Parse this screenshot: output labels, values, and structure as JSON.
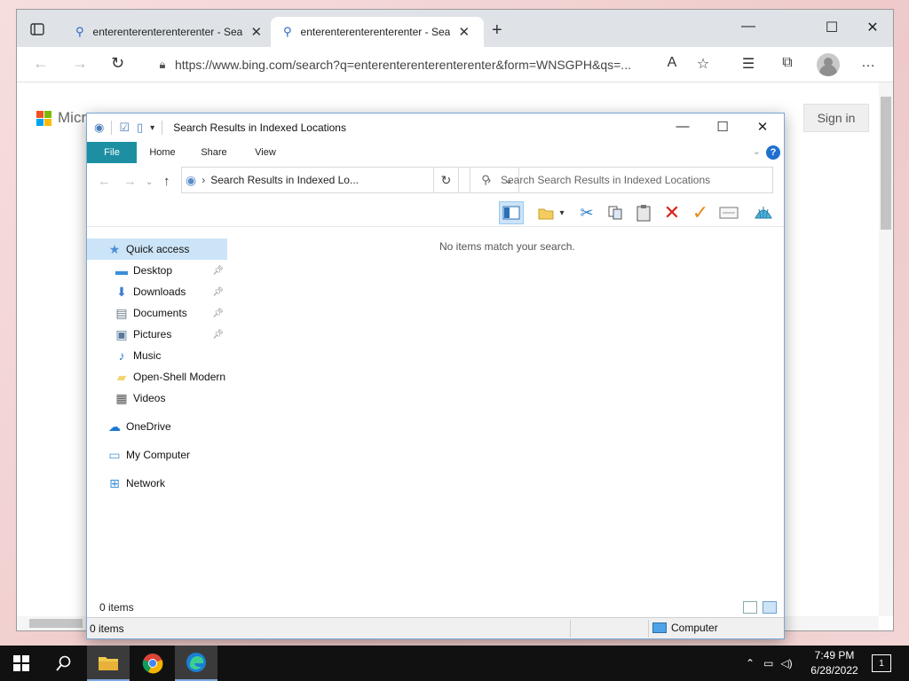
{
  "browser": {
    "tabs": [
      {
        "label": "enterenterenterenterenter - Search",
        "close": "✕"
      },
      {
        "label": "enterenterenterenterenter - Search",
        "close": "✕"
      }
    ],
    "new_tab": "+",
    "url": "https://www.bing.com/search?q=enterenterenterenterenter&form=WNSGPH&qs=...",
    "window_controls": {
      "minimize": "—",
      "maximize": "☐",
      "close": "✕"
    }
  },
  "bing": {
    "logo_text": "Micro",
    "sign_in": "Sign in",
    "logo_colors": [
      "#f25022",
      "#7fba00",
      "#00a4ef",
      "#ffb900"
    ]
  },
  "explorer": {
    "title": "Search Results in Indexed Locations",
    "ribbon_tabs": [
      "File",
      "Home",
      "Share",
      "View"
    ],
    "path_text": "Search Results in Indexed Lo...",
    "search_placeholder": "Search Search Results in Indexed Locations",
    "empty_message": "No items match your search.",
    "nav_items": [
      {
        "label": "Quick access",
        "icon": "star-icon",
        "glyph": "★",
        "color": "#4a90d9",
        "pinned": false,
        "indent": 0
      },
      {
        "label": "Desktop",
        "icon": "desktop-icon",
        "glyph": "▬",
        "color": "#3b8fd8",
        "pinned": true,
        "indent": 1
      },
      {
        "label": "Downloads",
        "icon": "download-icon",
        "glyph": "⬇",
        "color": "#3a7bd5",
        "pinned": true,
        "indent": 1
      },
      {
        "label": "Documents",
        "icon": "documents-icon",
        "glyph": "▤",
        "color": "#6b7b8a",
        "pinned": true,
        "indent": 1
      },
      {
        "label": "Pictures",
        "icon": "pictures-icon",
        "glyph": "▣",
        "color": "#5a7a9a",
        "pinned": true,
        "indent": 1
      },
      {
        "label": "Music",
        "icon": "music-icon",
        "glyph": "♪",
        "color": "#2a7fd4",
        "pinned": false,
        "indent": 1
      },
      {
        "label": "Open-Shell Modern",
        "icon": "folder-icon",
        "glyph": "▰",
        "color": "#f2d675",
        "pinned": false,
        "indent": 1
      },
      {
        "label": "Videos",
        "icon": "videos-icon",
        "glyph": "▦",
        "color": "#555",
        "pinned": false,
        "indent": 1
      },
      {
        "label": "OneDrive",
        "icon": "cloud-icon",
        "glyph": "☁",
        "color": "#1a78d6",
        "pinned": false,
        "indent": 0
      },
      {
        "label": "My Computer",
        "icon": "computer-icon",
        "glyph": "▭",
        "color": "#3b8fd8",
        "pinned": false,
        "indent": 0
      },
      {
        "label": "Network",
        "icon": "network-icon",
        "glyph": "⊞",
        "color": "#3b8fd8",
        "pinned": false,
        "indent": 0
      }
    ],
    "status_count": "0 items",
    "bottom_count": "0 items",
    "bottom_location": "Computer"
  },
  "taskbar": {
    "time": "7:49 PM",
    "date": "6/28/2022",
    "notification_count": "1"
  }
}
